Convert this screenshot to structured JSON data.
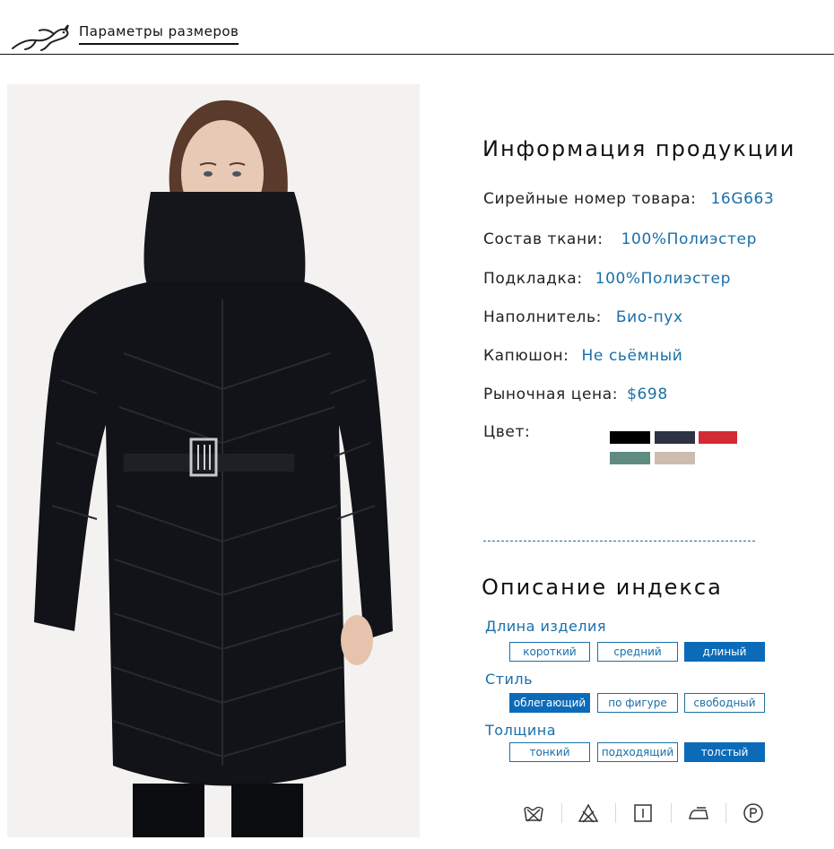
{
  "header": {
    "title": "Параметры размеров"
  },
  "product_info": {
    "title": "Информация продукции",
    "specs": [
      {
        "label": "Сирейные номер товара:",
        "value": "16G663"
      },
      {
        "label": "Состав ткани:",
        "value": "100%Полиэстер"
      },
      {
        "label": "Подкладка:",
        "value": "100%Полиэстер"
      },
      {
        "label": "Наполнитель:",
        "value": "Био-пух"
      },
      {
        "label": "Капюшон:",
        "value": "Не сьёмный"
      },
      {
        "label": "Рыночная цена:",
        "value": "$698"
      }
    ],
    "color_label": "Цвет:",
    "colors": [
      "#000000",
      "#2e3244",
      "#d42a35",
      "#5f8b80",
      "#cdbcb0"
    ]
  },
  "index": {
    "title": "Описание индекса",
    "categories": [
      {
        "label": "Длина изделия",
        "options": [
          "короткий",
          "средний",
          "длиный"
        ],
        "selected": 2
      },
      {
        "label": "Стиль",
        "options": [
          "облегающий",
          "по фигуре",
          "свободный"
        ],
        "selected": 0
      },
      {
        "label": "Толщина",
        "options": [
          "тонкий",
          "подходящий",
          "толстый"
        ],
        "selected": 2
      }
    ]
  },
  "care_icons": [
    "no-wash-icon",
    "no-bleach-icon",
    "tumble-dry-icon",
    "iron-icon",
    "dry-clean-p-icon"
  ],
  "accent_color": "#1a6fa8",
  "active_color": "#0b6bb8"
}
